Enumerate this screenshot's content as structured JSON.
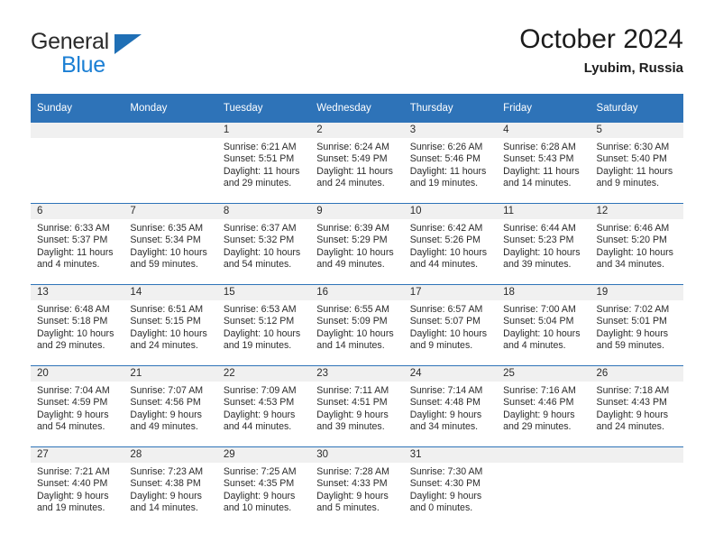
{
  "brand": {
    "line1": "General",
    "line2": "Blue",
    "triangle_color": "#1f6fb5",
    "line2_color": "#1b7fd4"
  },
  "header": {
    "title": "October 2024",
    "subtitle": "Lyubim, Russia"
  },
  "colors": {
    "header_blue": "#2e73b8",
    "daynum_band": "#f0f0f0",
    "row_divider": "#2e73b8",
    "text": "#2b2b2b"
  },
  "calendar": {
    "weekday_headers": [
      "Sunday",
      "Monday",
      "Tuesday",
      "Wednesday",
      "Thursday",
      "Friday",
      "Saturday"
    ],
    "labels": {
      "sunrise": "Sunrise:",
      "sunset": "Sunset:",
      "daylight": "Daylight:"
    },
    "weeks": [
      [
        {
          "day": "",
          "sunrise": "",
          "sunset": "",
          "daylight_1": "",
          "daylight_2": ""
        },
        {
          "day": "",
          "sunrise": "",
          "sunset": "",
          "daylight_1": "",
          "daylight_2": ""
        },
        {
          "day": "1",
          "sunrise": "Sunrise: 6:21 AM",
          "sunset": "Sunset: 5:51 PM",
          "daylight_1": "Daylight: 11 hours",
          "daylight_2": "and 29 minutes."
        },
        {
          "day": "2",
          "sunrise": "Sunrise: 6:24 AM",
          "sunset": "Sunset: 5:49 PM",
          "daylight_1": "Daylight: 11 hours",
          "daylight_2": "and 24 minutes."
        },
        {
          "day": "3",
          "sunrise": "Sunrise: 6:26 AM",
          "sunset": "Sunset: 5:46 PM",
          "daylight_1": "Daylight: 11 hours",
          "daylight_2": "and 19 minutes."
        },
        {
          "day": "4",
          "sunrise": "Sunrise: 6:28 AM",
          "sunset": "Sunset: 5:43 PM",
          "daylight_1": "Daylight: 11 hours",
          "daylight_2": "and 14 minutes."
        },
        {
          "day": "5",
          "sunrise": "Sunrise: 6:30 AM",
          "sunset": "Sunset: 5:40 PM",
          "daylight_1": "Daylight: 11 hours",
          "daylight_2": "and 9 minutes."
        }
      ],
      [
        {
          "day": "6",
          "sunrise": "Sunrise: 6:33 AM",
          "sunset": "Sunset: 5:37 PM",
          "daylight_1": "Daylight: 11 hours",
          "daylight_2": "and 4 minutes."
        },
        {
          "day": "7",
          "sunrise": "Sunrise: 6:35 AM",
          "sunset": "Sunset: 5:34 PM",
          "daylight_1": "Daylight: 10 hours",
          "daylight_2": "and 59 minutes."
        },
        {
          "day": "8",
          "sunrise": "Sunrise: 6:37 AM",
          "sunset": "Sunset: 5:32 PM",
          "daylight_1": "Daylight: 10 hours",
          "daylight_2": "and 54 minutes."
        },
        {
          "day": "9",
          "sunrise": "Sunrise: 6:39 AM",
          "sunset": "Sunset: 5:29 PM",
          "daylight_1": "Daylight: 10 hours",
          "daylight_2": "and 49 minutes."
        },
        {
          "day": "10",
          "sunrise": "Sunrise: 6:42 AM",
          "sunset": "Sunset: 5:26 PM",
          "daylight_1": "Daylight: 10 hours",
          "daylight_2": "and 44 minutes."
        },
        {
          "day": "11",
          "sunrise": "Sunrise: 6:44 AM",
          "sunset": "Sunset: 5:23 PM",
          "daylight_1": "Daylight: 10 hours",
          "daylight_2": "and 39 minutes."
        },
        {
          "day": "12",
          "sunrise": "Sunrise: 6:46 AM",
          "sunset": "Sunset: 5:20 PM",
          "daylight_1": "Daylight: 10 hours",
          "daylight_2": "and 34 minutes."
        }
      ],
      [
        {
          "day": "13",
          "sunrise": "Sunrise: 6:48 AM",
          "sunset": "Sunset: 5:18 PM",
          "daylight_1": "Daylight: 10 hours",
          "daylight_2": "and 29 minutes."
        },
        {
          "day": "14",
          "sunrise": "Sunrise: 6:51 AM",
          "sunset": "Sunset: 5:15 PM",
          "daylight_1": "Daylight: 10 hours",
          "daylight_2": "and 24 minutes."
        },
        {
          "day": "15",
          "sunrise": "Sunrise: 6:53 AM",
          "sunset": "Sunset: 5:12 PM",
          "daylight_1": "Daylight: 10 hours",
          "daylight_2": "and 19 minutes."
        },
        {
          "day": "16",
          "sunrise": "Sunrise: 6:55 AM",
          "sunset": "Sunset: 5:09 PM",
          "daylight_1": "Daylight: 10 hours",
          "daylight_2": "and 14 minutes."
        },
        {
          "day": "17",
          "sunrise": "Sunrise: 6:57 AM",
          "sunset": "Sunset: 5:07 PM",
          "daylight_1": "Daylight: 10 hours",
          "daylight_2": "and 9 minutes."
        },
        {
          "day": "18",
          "sunrise": "Sunrise: 7:00 AM",
          "sunset": "Sunset: 5:04 PM",
          "daylight_1": "Daylight: 10 hours",
          "daylight_2": "and 4 minutes."
        },
        {
          "day": "19",
          "sunrise": "Sunrise: 7:02 AM",
          "sunset": "Sunset: 5:01 PM",
          "daylight_1": "Daylight: 9 hours",
          "daylight_2": "and 59 minutes."
        }
      ],
      [
        {
          "day": "20",
          "sunrise": "Sunrise: 7:04 AM",
          "sunset": "Sunset: 4:59 PM",
          "daylight_1": "Daylight: 9 hours",
          "daylight_2": "and 54 minutes."
        },
        {
          "day": "21",
          "sunrise": "Sunrise: 7:07 AM",
          "sunset": "Sunset: 4:56 PM",
          "daylight_1": "Daylight: 9 hours",
          "daylight_2": "and 49 minutes."
        },
        {
          "day": "22",
          "sunrise": "Sunrise: 7:09 AM",
          "sunset": "Sunset: 4:53 PM",
          "daylight_1": "Daylight: 9 hours",
          "daylight_2": "and 44 minutes."
        },
        {
          "day": "23",
          "sunrise": "Sunrise: 7:11 AM",
          "sunset": "Sunset: 4:51 PM",
          "daylight_1": "Daylight: 9 hours",
          "daylight_2": "and 39 minutes."
        },
        {
          "day": "24",
          "sunrise": "Sunrise: 7:14 AM",
          "sunset": "Sunset: 4:48 PM",
          "daylight_1": "Daylight: 9 hours",
          "daylight_2": "and 34 minutes."
        },
        {
          "day": "25",
          "sunrise": "Sunrise: 7:16 AM",
          "sunset": "Sunset: 4:46 PM",
          "daylight_1": "Daylight: 9 hours",
          "daylight_2": "and 29 minutes."
        },
        {
          "day": "26",
          "sunrise": "Sunrise: 7:18 AM",
          "sunset": "Sunset: 4:43 PM",
          "daylight_1": "Daylight: 9 hours",
          "daylight_2": "and 24 minutes."
        }
      ],
      [
        {
          "day": "27",
          "sunrise": "Sunrise: 7:21 AM",
          "sunset": "Sunset: 4:40 PM",
          "daylight_1": "Daylight: 9 hours",
          "daylight_2": "and 19 minutes."
        },
        {
          "day": "28",
          "sunrise": "Sunrise: 7:23 AM",
          "sunset": "Sunset: 4:38 PM",
          "daylight_1": "Daylight: 9 hours",
          "daylight_2": "and 14 minutes."
        },
        {
          "day": "29",
          "sunrise": "Sunrise: 7:25 AM",
          "sunset": "Sunset: 4:35 PM",
          "daylight_1": "Daylight: 9 hours",
          "daylight_2": "and 10 minutes."
        },
        {
          "day": "30",
          "sunrise": "Sunrise: 7:28 AM",
          "sunset": "Sunset: 4:33 PM",
          "daylight_1": "Daylight: 9 hours",
          "daylight_2": "and 5 minutes."
        },
        {
          "day": "31",
          "sunrise": "Sunrise: 7:30 AM",
          "sunset": "Sunset: 4:30 PM",
          "daylight_1": "Daylight: 9 hours",
          "daylight_2": "and 0 minutes."
        },
        {
          "day": "",
          "sunrise": "",
          "sunset": "",
          "daylight_1": "",
          "daylight_2": ""
        },
        {
          "day": "",
          "sunrise": "",
          "sunset": "",
          "daylight_1": "",
          "daylight_2": ""
        }
      ]
    ]
  }
}
